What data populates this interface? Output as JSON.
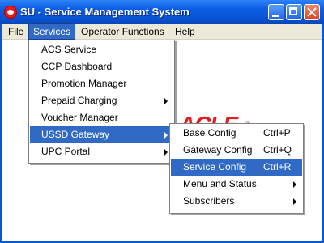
{
  "window": {
    "title": "SU - Service Management System",
    "app_icon": "oracle-icon",
    "controls": [
      "minimize",
      "maximize",
      "close"
    ]
  },
  "menubar": {
    "items": [
      {
        "label": "File"
      },
      {
        "label": "Services",
        "active": true
      },
      {
        "label": "Operator Functions"
      },
      {
        "label": "Help"
      }
    ]
  },
  "services_menu": {
    "items": [
      {
        "label": "ACS Service"
      },
      {
        "label": "CCP Dashboard"
      },
      {
        "label": "Promotion Manager"
      },
      {
        "label": "Prepaid Charging",
        "submenu": true
      },
      {
        "label": "Voucher Manager"
      },
      {
        "label": "USSD Gateway",
        "submenu": true,
        "selected": true
      },
      {
        "label": "UPC Portal",
        "submenu": true
      }
    ]
  },
  "ussd_submenu": {
    "items": [
      {
        "label": "Base Config",
        "accelerator": "Ctrl+P"
      },
      {
        "label": "Gateway Config",
        "accelerator": "Ctrl+Q"
      },
      {
        "label": "Service Config",
        "accelerator": "Ctrl+R",
        "selected": true
      },
      {
        "label": "Menu and Status",
        "submenu": true
      },
      {
        "label": "Subscribers",
        "submenu": true
      }
    ]
  },
  "colors": {
    "titlebar": "#0a56d6",
    "selection": "#316ac5",
    "menubar": "#ece9d8",
    "logo": "#e31b1b"
  }
}
